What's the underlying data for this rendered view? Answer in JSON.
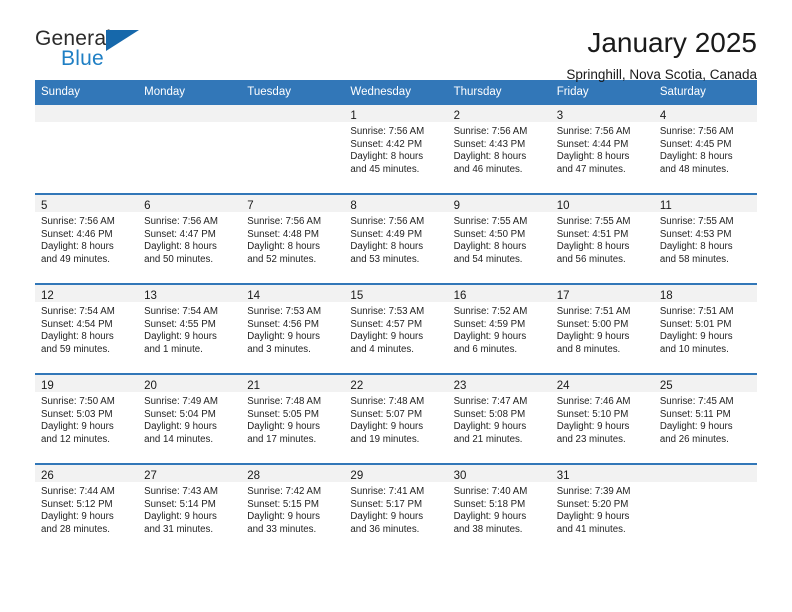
{
  "brand": {
    "name_part1": "General",
    "name_part2": "Blue",
    "accent_color": "#1668ab",
    "blue_text_color": "#1f7fc4"
  },
  "header": {
    "title": "January 2025",
    "subtitle": "Springhill, Nova Scotia, Canada"
  },
  "calendar": {
    "header_bg": "#3277b8",
    "weekdays": [
      "Sunday",
      "Monday",
      "Tuesday",
      "Wednesday",
      "Thursday",
      "Friday",
      "Saturday"
    ],
    "weeks": [
      [
        {
          "day": "",
          "sunrise": "",
          "sunset": "",
          "daylight1": "",
          "daylight2": ""
        },
        {
          "day": "",
          "sunrise": "",
          "sunset": "",
          "daylight1": "",
          "daylight2": ""
        },
        {
          "day": "",
          "sunrise": "",
          "sunset": "",
          "daylight1": "",
          "daylight2": ""
        },
        {
          "day": "1",
          "sunrise": "Sunrise: 7:56 AM",
          "sunset": "Sunset: 4:42 PM",
          "daylight1": "Daylight: 8 hours",
          "daylight2": "and 45 minutes."
        },
        {
          "day": "2",
          "sunrise": "Sunrise: 7:56 AM",
          "sunset": "Sunset: 4:43 PM",
          "daylight1": "Daylight: 8 hours",
          "daylight2": "and 46 minutes."
        },
        {
          "day": "3",
          "sunrise": "Sunrise: 7:56 AM",
          "sunset": "Sunset: 4:44 PM",
          "daylight1": "Daylight: 8 hours",
          "daylight2": "and 47 minutes."
        },
        {
          "day": "4",
          "sunrise": "Sunrise: 7:56 AM",
          "sunset": "Sunset: 4:45 PM",
          "daylight1": "Daylight: 8 hours",
          "daylight2": "and 48 minutes."
        }
      ],
      [
        {
          "day": "5",
          "sunrise": "Sunrise: 7:56 AM",
          "sunset": "Sunset: 4:46 PM",
          "daylight1": "Daylight: 8 hours",
          "daylight2": "and 49 minutes."
        },
        {
          "day": "6",
          "sunrise": "Sunrise: 7:56 AM",
          "sunset": "Sunset: 4:47 PM",
          "daylight1": "Daylight: 8 hours",
          "daylight2": "and 50 minutes."
        },
        {
          "day": "7",
          "sunrise": "Sunrise: 7:56 AM",
          "sunset": "Sunset: 4:48 PM",
          "daylight1": "Daylight: 8 hours",
          "daylight2": "and 52 minutes."
        },
        {
          "day": "8",
          "sunrise": "Sunrise: 7:56 AM",
          "sunset": "Sunset: 4:49 PM",
          "daylight1": "Daylight: 8 hours",
          "daylight2": "and 53 minutes."
        },
        {
          "day": "9",
          "sunrise": "Sunrise: 7:55 AM",
          "sunset": "Sunset: 4:50 PM",
          "daylight1": "Daylight: 8 hours",
          "daylight2": "and 54 minutes."
        },
        {
          "day": "10",
          "sunrise": "Sunrise: 7:55 AM",
          "sunset": "Sunset: 4:51 PM",
          "daylight1": "Daylight: 8 hours",
          "daylight2": "and 56 minutes."
        },
        {
          "day": "11",
          "sunrise": "Sunrise: 7:55 AM",
          "sunset": "Sunset: 4:53 PM",
          "daylight1": "Daylight: 8 hours",
          "daylight2": "and 58 minutes."
        }
      ],
      [
        {
          "day": "12",
          "sunrise": "Sunrise: 7:54 AM",
          "sunset": "Sunset: 4:54 PM",
          "daylight1": "Daylight: 8 hours",
          "daylight2": "and 59 minutes."
        },
        {
          "day": "13",
          "sunrise": "Sunrise: 7:54 AM",
          "sunset": "Sunset: 4:55 PM",
          "daylight1": "Daylight: 9 hours",
          "daylight2": "and 1 minute."
        },
        {
          "day": "14",
          "sunrise": "Sunrise: 7:53 AM",
          "sunset": "Sunset: 4:56 PM",
          "daylight1": "Daylight: 9 hours",
          "daylight2": "and 3 minutes."
        },
        {
          "day": "15",
          "sunrise": "Sunrise: 7:53 AM",
          "sunset": "Sunset: 4:57 PM",
          "daylight1": "Daylight: 9 hours",
          "daylight2": "and 4 minutes."
        },
        {
          "day": "16",
          "sunrise": "Sunrise: 7:52 AM",
          "sunset": "Sunset: 4:59 PM",
          "daylight1": "Daylight: 9 hours",
          "daylight2": "and 6 minutes."
        },
        {
          "day": "17",
          "sunrise": "Sunrise: 7:51 AM",
          "sunset": "Sunset: 5:00 PM",
          "daylight1": "Daylight: 9 hours",
          "daylight2": "and 8 minutes."
        },
        {
          "day": "18",
          "sunrise": "Sunrise: 7:51 AM",
          "sunset": "Sunset: 5:01 PM",
          "daylight1": "Daylight: 9 hours",
          "daylight2": "and 10 minutes."
        }
      ],
      [
        {
          "day": "19",
          "sunrise": "Sunrise: 7:50 AM",
          "sunset": "Sunset: 5:03 PM",
          "daylight1": "Daylight: 9 hours",
          "daylight2": "and 12 minutes."
        },
        {
          "day": "20",
          "sunrise": "Sunrise: 7:49 AM",
          "sunset": "Sunset: 5:04 PM",
          "daylight1": "Daylight: 9 hours",
          "daylight2": "and 14 minutes."
        },
        {
          "day": "21",
          "sunrise": "Sunrise: 7:48 AM",
          "sunset": "Sunset: 5:05 PM",
          "daylight1": "Daylight: 9 hours",
          "daylight2": "and 17 minutes."
        },
        {
          "day": "22",
          "sunrise": "Sunrise: 7:48 AM",
          "sunset": "Sunset: 5:07 PM",
          "daylight1": "Daylight: 9 hours",
          "daylight2": "and 19 minutes."
        },
        {
          "day": "23",
          "sunrise": "Sunrise: 7:47 AM",
          "sunset": "Sunset: 5:08 PM",
          "daylight1": "Daylight: 9 hours",
          "daylight2": "and 21 minutes."
        },
        {
          "day": "24",
          "sunrise": "Sunrise: 7:46 AM",
          "sunset": "Sunset: 5:10 PM",
          "daylight1": "Daylight: 9 hours",
          "daylight2": "and 23 minutes."
        },
        {
          "day": "25",
          "sunrise": "Sunrise: 7:45 AM",
          "sunset": "Sunset: 5:11 PM",
          "daylight1": "Daylight: 9 hours",
          "daylight2": "and 26 minutes."
        }
      ],
      [
        {
          "day": "26",
          "sunrise": "Sunrise: 7:44 AM",
          "sunset": "Sunset: 5:12 PM",
          "daylight1": "Daylight: 9 hours",
          "daylight2": "and 28 minutes."
        },
        {
          "day": "27",
          "sunrise": "Sunrise: 7:43 AM",
          "sunset": "Sunset: 5:14 PM",
          "daylight1": "Daylight: 9 hours",
          "daylight2": "and 31 minutes."
        },
        {
          "day": "28",
          "sunrise": "Sunrise: 7:42 AM",
          "sunset": "Sunset: 5:15 PM",
          "daylight1": "Daylight: 9 hours",
          "daylight2": "and 33 minutes."
        },
        {
          "day": "29",
          "sunrise": "Sunrise: 7:41 AM",
          "sunset": "Sunset: 5:17 PM",
          "daylight1": "Daylight: 9 hours",
          "daylight2": "and 36 minutes."
        },
        {
          "day": "30",
          "sunrise": "Sunrise: 7:40 AM",
          "sunset": "Sunset: 5:18 PM",
          "daylight1": "Daylight: 9 hours",
          "daylight2": "and 38 minutes."
        },
        {
          "day": "31",
          "sunrise": "Sunrise: 7:39 AM",
          "sunset": "Sunset: 5:20 PM",
          "daylight1": "Daylight: 9 hours",
          "daylight2": "and 41 minutes."
        },
        {
          "day": "",
          "sunrise": "",
          "sunset": "",
          "daylight1": "",
          "daylight2": ""
        }
      ]
    ]
  }
}
